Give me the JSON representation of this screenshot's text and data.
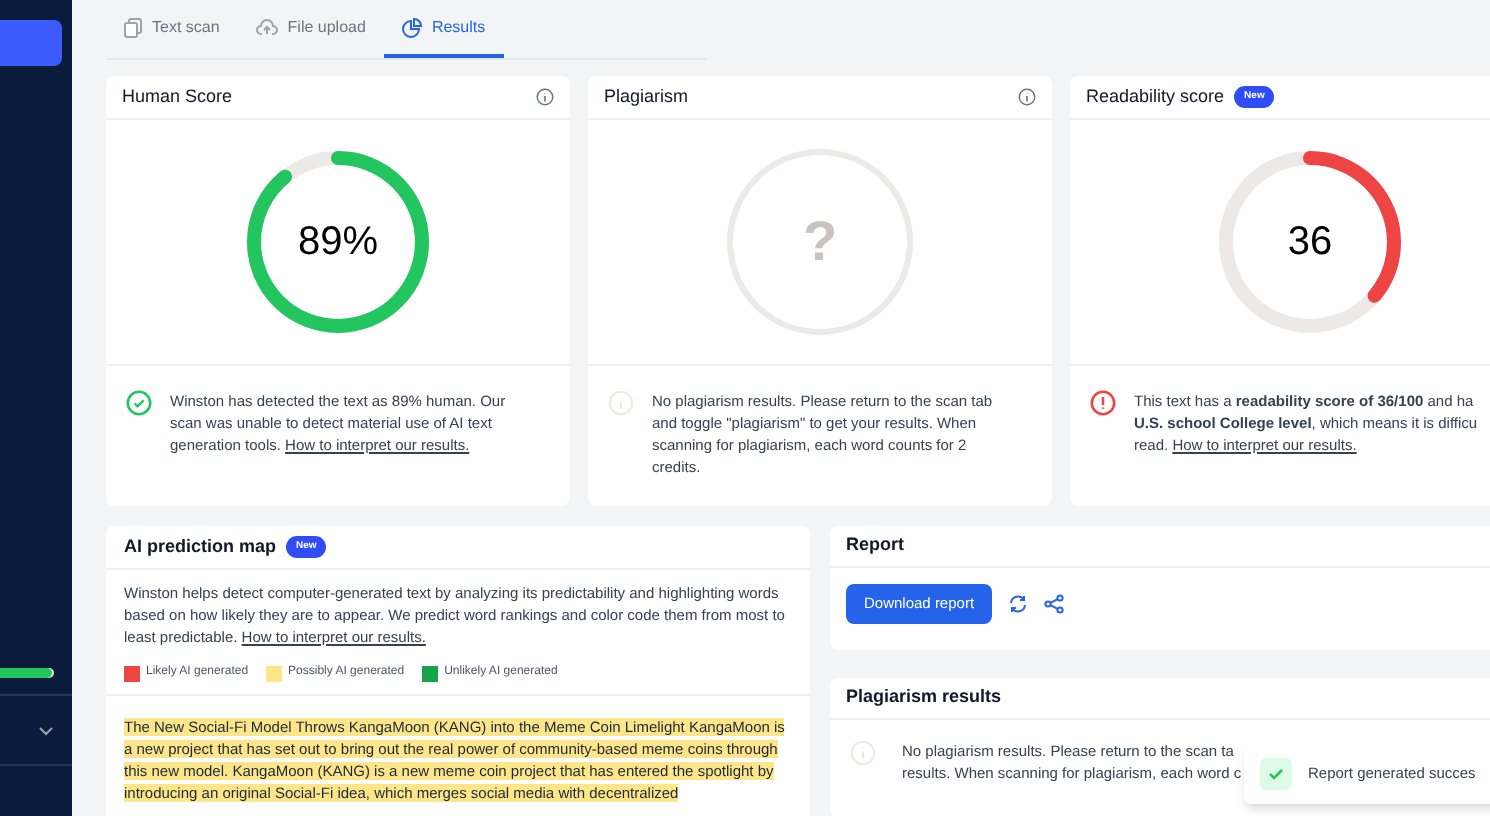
{
  "sidebar": {
    "progress": {
      "level": 0.97
    }
  },
  "tabs": [
    {
      "label": "Text scan",
      "selected": false
    },
    {
      "label": "File upload",
      "selected": false
    },
    {
      "label": "Results",
      "selected": true
    }
  ],
  "score_cards": [
    {
      "title": "Human Score",
      "kind": "pass",
      "value": "89%",
      "level": 0.89,
      "color": "#22c55e",
      "lines": [
        "Winston has detected the text as 89% human. Our",
        "scan was unable to detect material use of AI text",
        "generation tools. "
      ],
      "link": "How to interpret our results."
    },
    {
      "title": "Plagiarism",
      "kind": "none",
      "value": "?",
      "lines": [
        "No plagiarism results. Please return to the scan tab",
        "and toggle \"plagiarism\" to get your results. When",
        "scanning for plagiarism, each word counts for 2",
        "credits."
      ]
    },
    {
      "title": "Readability score",
      "kind": "alert",
      "badge": "New",
      "value": "36",
      "level": 0.36,
      "color": "#ef4444",
      "lines": [
        "This text has a **readability score of 36/100** and ha",
        "**U.S. school College level**, which means it is difficu",
        "read. "
      ],
      "link": "How to interpret our results."
    }
  ],
  "prediction_map": {
    "title": "AI prediction map",
    "badge": "New",
    "description": "Winston helps detect computer-generated text by analyzing its predictability and highlighting words based on how likely they are to appear. We predict word rankings and color code them from most to least predictable. ",
    "link": "How to interpret our results.",
    "legend": [
      {
        "label": "Likely AI generated",
        "color": "#ef4444"
      },
      {
        "label": "Possibly AI generated",
        "color": "#fde68a"
      },
      {
        "label": "Unlikely AI generated",
        "color": "#16a34a"
      }
    ],
    "text": "The New Social-Fi Model Throws KangaMoon (KANG) into the Meme Coin Limelight KangaMoon is a new project that has set out to bring out the real power of community-based meme coins through this new model. KangaMoon (KANG) is a new meme coin project that has entered the spotlight by introducing an original Social-Fi idea, which merges social media with decentralized"
  },
  "report": {
    "title": "Report",
    "button": "Download report"
  },
  "plagiarism_results": {
    "title": "Plagiarism results",
    "lines": [
      "No plagiarism results. Please return to the scan ta",
      "results. When scanning for plagiarism, each word c"
    ]
  },
  "toast": {
    "text": "Report generated succes"
  }
}
